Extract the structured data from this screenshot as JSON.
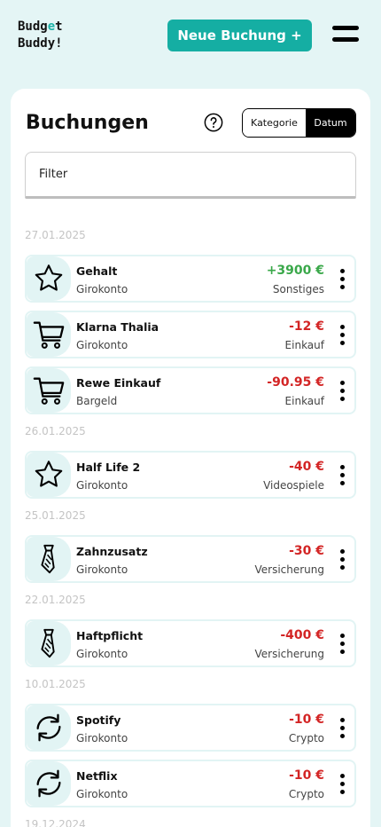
{
  "app": {
    "logo_line1_a": "Budg",
    "logo_line1_accent": "e",
    "logo_line1_b": "t",
    "logo_line2": "Buddy!",
    "new_booking_label": "Neue Buchung +",
    "accent_color": "#15aea3"
  },
  "page": {
    "title": "Buchungen",
    "toggle": {
      "option1": "Kategorie",
      "option2": "Datum",
      "selected": "Datum"
    },
    "filter_placeholder": "Filter"
  },
  "groups": [
    {
      "date": "27.01.2025",
      "items": [
        {
          "title": "Gehalt",
          "account": "Girokonto",
          "amount": "+3900 €",
          "category": "Sonstiges",
          "icon": "star-icon",
          "positive": true
        },
        {
          "title": "Klarna Thalia",
          "account": "Girokonto",
          "amount": "-12 €",
          "category": "Einkauf",
          "icon": "cart-icon",
          "positive": false
        },
        {
          "title": "Rewe Einkauf",
          "account": "Bargeld",
          "amount": "-90.95 €",
          "category": "Einkauf",
          "icon": "cart-icon",
          "positive": false
        }
      ]
    },
    {
      "date": "26.01.2025",
      "items": [
        {
          "title": "Half Life 2",
          "account": "Girokonto",
          "amount": "-40 €",
          "category": "Videospiele",
          "icon": "star-icon",
          "positive": false
        }
      ]
    },
    {
      "date": "25.01.2025",
      "items": [
        {
          "title": "Zahnzusatz",
          "account": "Girokonto",
          "amount": "-30 €",
          "category": "Versicherung",
          "icon": "tie-icon",
          "positive": false
        }
      ]
    },
    {
      "date": "22.01.2025",
      "items": [
        {
          "title": "Haftpflicht",
          "account": "Girokonto",
          "amount": "-400 €",
          "category": "Versicherung",
          "icon": "tie-icon",
          "positive": false
        }
      ]
    },
    {
      "date": "10.01.2025",
      "items": [
        {
          "title": "Spotify",
          "account": "Girokonto",
          "amount": "-10 €",
          "category": "Crypto",
          "icon": "repeat-icon",
          "positive": false
        },
        {
          "title": "Netflix",
          "account": "Girokonto",
          "amount": "-10 €",
          "category": "Crypto",
          "icon": "repeat-icon",
          "positive": false
        }
      ]
    },
    {
      "date": "19.12.2024",
      "items": []
    }
  ]
}
